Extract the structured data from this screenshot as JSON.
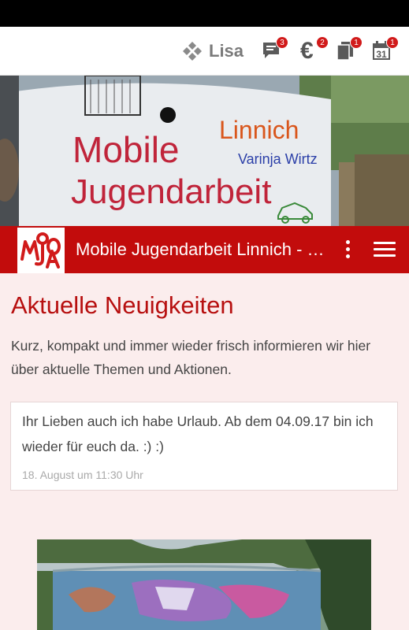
{
  "header": {
    "user_name": "Lisa",
    "icons": [
      {
        "name": "chat-icon",
        "badge": "3"
      },
      {
        "name": "euro-icon",
        "badge": "2",
        "glyph": "€"
      },
      {
        "name": "documents-icon",
        "badge": "1"
      },
      {
        "name": "calendar-icon",
        "badge": "1",
        "day": "31"
      }
    ]
  },
  "hero": {
    "wall_text_line1": "Mobile",
    "wall_text_line2": "Jugendarbeit",
    "wall_text_linnich": "Linnich",
    "wall_text_name": "Varinja Wirtz"
  },
  "app_bar": {
    "title": "Mobile Jugendarbeit Linnich - Home"
  },
  "main": {
    "title": "Aktuelle Neuigkeiten",
    "intro": "Kurz, kompakt und immer wieder frisch informieren wir hier über aktuelle Themen und Aktionen.",
    "news": [
      {
        "text": "Ihr Lieben auch ich habe Urlaub. Ab dem 04.09.17 bin ich wieder für euch da. :) :)",
        "date": "18. August um 11:30 Uhr"
      }
    ]
  },
  "colors": {
    "brand_red": "#c20c0c",
    "title_red": "#b70f0f",
    "page_bg": "#fbeded",
    "badge_red": "#d11a1a"
  }
}
